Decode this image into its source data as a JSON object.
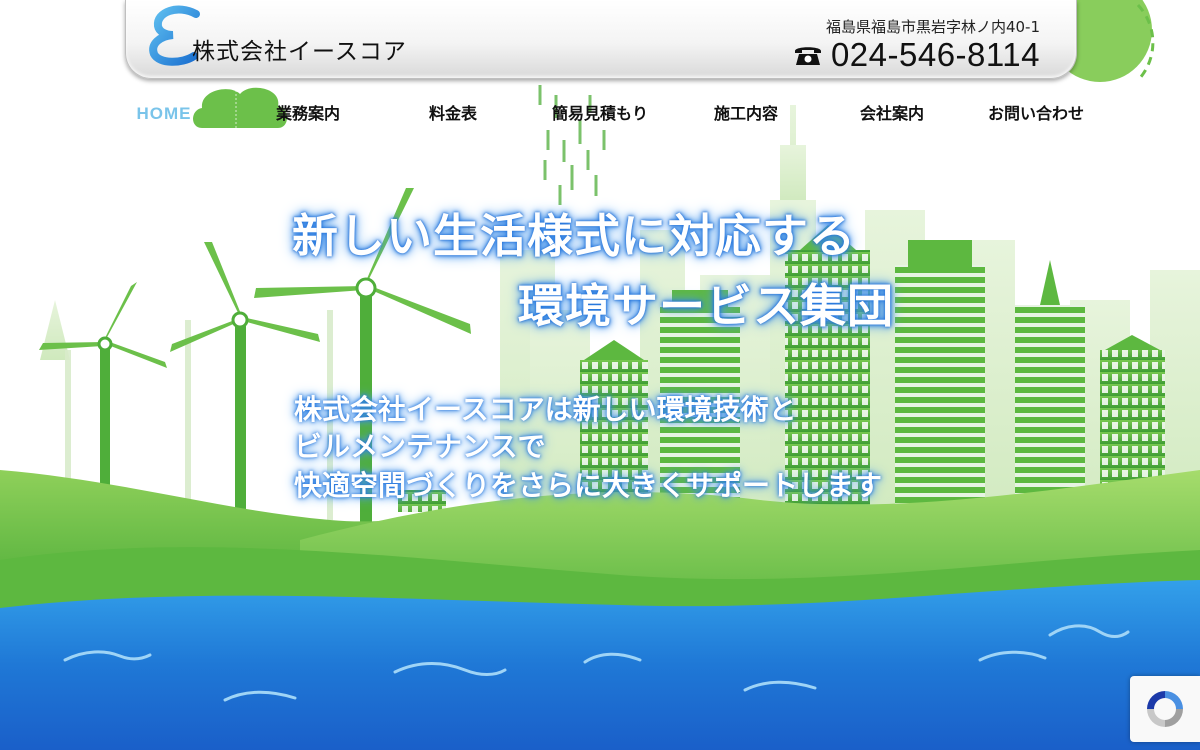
{
  "header": {
    "company_name": "株式会社イースコア",
    "address": "福島県福島市黒岩字林ノ内40-1",
    "phone": "024-546-8114"
  },
  "nav": {
    "items": [
      {
        "label": "HOME",
        "active": true
      },
      {
        "label": "業務案内"
      },
      {
        "label": "料金表"
      },
      {
        "label": "簡易見積もり"
      },
      {
        "label": "施工内容"
      },
      {
        "label": "会社案内"
      },
      {
        "label": "お問い合わせ"
      }
    ]
  },
  "hero": {
    "headline_line1": "新しい生活様式に対応する",
    "headline_line2": "環境サービス集団",
    "body_line1": "株式会社イースコアは新しい環境技術と",
    "body_line2": "ビルメンテナンスで",
    "body_line3": "快適空間づくりをさらに大きくサポートします"
  },
  "colors": {
    "accent_green": "#6cc04a",
    "sky_blue": "#7ac4ea",
    "river_blue": "#1f78d6",
    "text_glow": "#3b8be8"
  },
  "icons": [
    "logo-e-icon",
    "telephone-icon",
    "wind-turbine-icon",
    "city-buildings-icon",
    "recaptcha-icon"
  ]
}
